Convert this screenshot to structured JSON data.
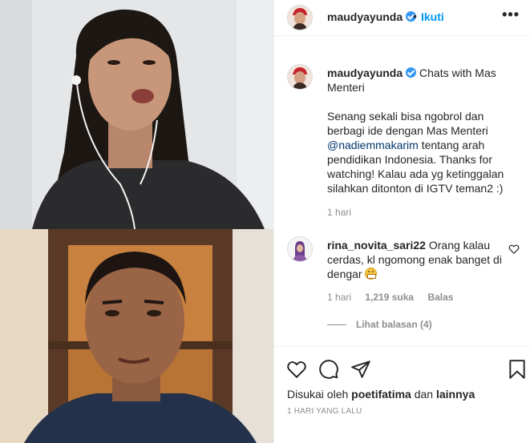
{
  "post": {
    "username": "maudyayunda",
    "follow_separator": "•",
    "follow_label": "Ikuti",
    "more_label": "•••",
    "date": "1 HARI YANG LALU"
  },
  "caption": {
    "username": "maudyayunda",
    "title": "Chats with Mas Menteri",
    "body_1": "Senang sekali bisa ngobrol dan berbagi ide dengan Mas Menteri",
    "mention": "@nadiemmakarim",
    "body_2": "tentang arah pendidikan Indonesia. Thanks for watching! Kalau ada yg ketinggalan silahkan ditonton di IGTV teman2 :)",
    "time": "1 hari"
  },
  "comment": {
    "username": "rina_novita_sari22",
    "text": "Orang kalau cerdas, kl ngomong enak banget di dengar",
    "time": "1 hari",
    "likes": "1,219 suka",
    "reply_label": "Balas",
    "view_replies": "Lihat balasan (4)"
  },
  "likes_summary": {
    "prefix": "Disukai oleh",
    "user": "poetifatima",
    "connector": "dan",
    "others": "lainnya"
  },
  "icons": {
    "like": "heart-icon",
    "comment": "comment-icon",
    "share": "paper-plane-icon",
    "save": "bookmark-icon",
    "verified": "verified-badge-icon",
    "more": "more-options-icon"
  },
  "colors": {
    "accent": "#0095f6",
    "verified": "#3897f0",
    "muted": "#8e8e8e",
    "text": "#262626",
    "mention": "#00376b"
  }
}
